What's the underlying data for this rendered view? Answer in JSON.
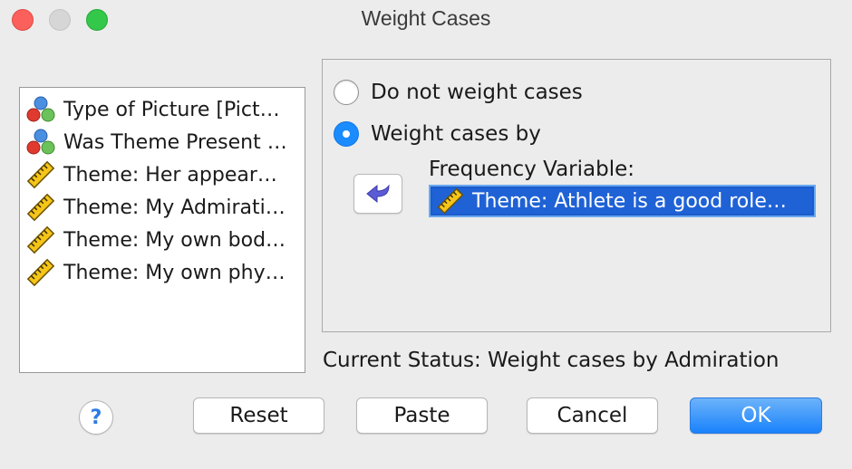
{
  "window": {
    "title": "Weight Cases"
  },
  "variables": [
    {
      "label": "Type of Picture [Pict…",
      "icon": "nominal-variable-icon"
    },
    {
      "label": "Was Theme Present …",
      "icon": "nominal-variable-icon"
    },
    {
      "label": "Theme: Her appear…",
      "icon": "scale-variable-icon"
    },
    {
      "label": "Theme: My Admirati…",
      "icon": "scale-variable-icon"
    },
    {
      "label": "Theme: My own bod…",
      "icon": "scale-variable-icon"
    },
    {
      "label": "Theme: My own phy…",
      "icon": "scale-variable-icon"
    }
  ],
  "options": {
    "no_weight_label": "Do not weight cases",
    "weight_by_label": "Weight cases by",
    "selected": "weight_by",
    "frequency_label": "Frequency Variable:",
    "frequency_value": "Theme: Athlete is a good role…"
  },
  "status": {
    "text": "Current Status: Weight cases by Admiration"
  },
  "buttons": {
    "help": "?",
    "reset": "Reset",
    "paste": "Paste",
    "cancel": "Cancel",
    "ok": "OK"
  },
  "colors": {
    "accent": "#1a82fb",
    "selection": "#1f62d6"
  }
}
